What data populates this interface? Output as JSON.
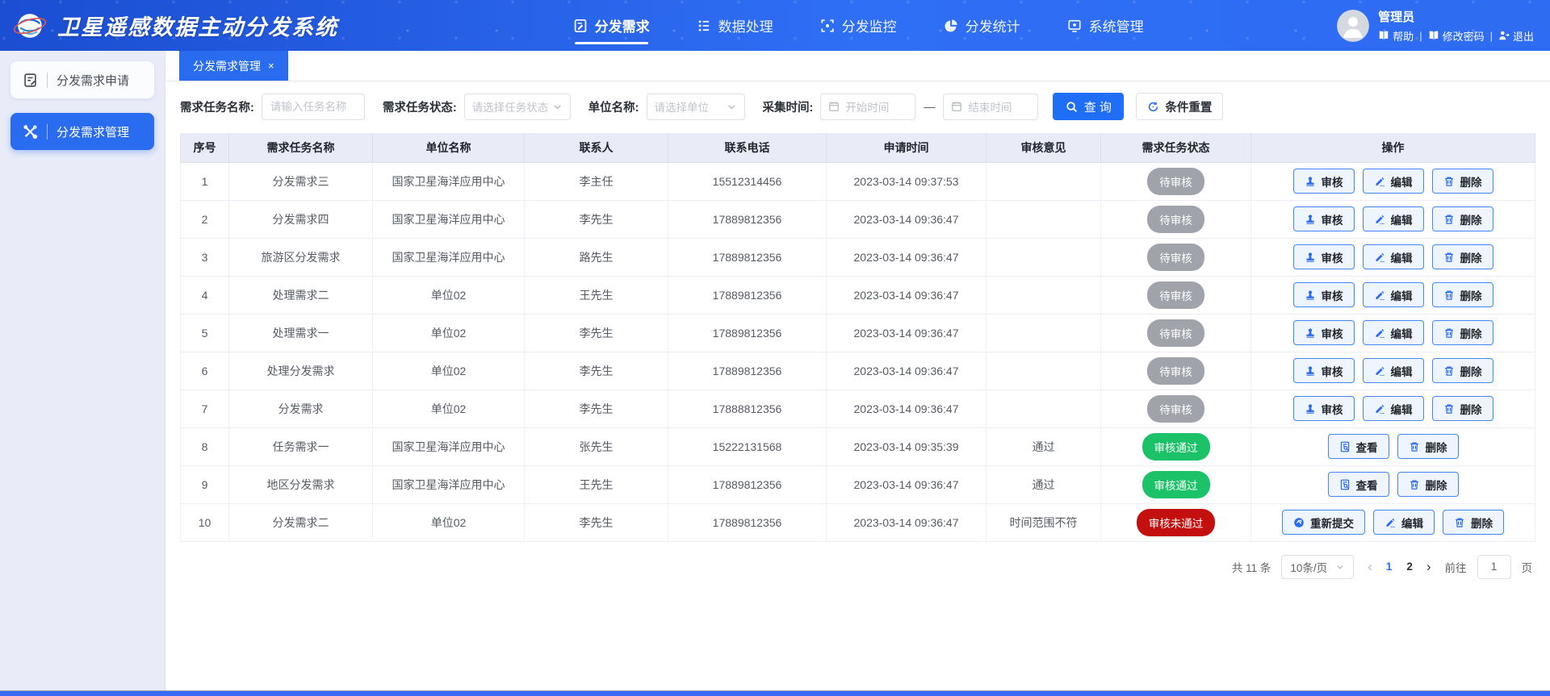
{
  "colors": {
    "accent": "#2a6cf0",
    "header_from": "#1b4ed2",
    "header_to": "#2f6ff5",
    "pending": "#a0a3aa",
    "approved": "#1cc268",
    "rejected": "#c40f0f"
  },
  "header": {
    "title": "卫星遥感数据主动分发系统",
    "nav": [
      {
        "label": "分发需求",
        "name": "distribution-demand",
        "icon": "doc-edit",
        "active": true
      },
      {
        "label": "数据处理",
        "name": "data-processing",
        "icon": "list",
        "active": false
      },
      {
        "label": "分发监控",
        "name": "distribution-monitor",
        "icon": "monitor",
        "active": false
      },
      {
        "label": "分发统计",
        "name": "distribution-stats",
        "icon": "pie",
        "active": false
      },
      {
        "label": "系统管理",
        "name": "system-management",
        "icon": "system",
        "active": false
      }
    ],
    "user": {
      "name": "管理员",
      "links": [
        {
          "label": "帮助",
          "name": "help",
          "icon": "book"
        },
        {
          "label": "修改密码",
          "name": "change-password",
          "icon": "book"
        },
        {
          "label": "退出",
          "name": "logout",
          "icon": "logout"
        }
      ],
      "separator": "|"
    }
  },
  "sidebar": {
    "items": [
      {
        "label": "分发需求申请",
        "name": "demand-apply",
        "icon": "clipboard",
        "active": false
      },
      {
        "label": "分发需求管理",
        "name": "demand-manage",
        "icon": "tools",
        "active": true
      }
    ]
  },
  "tab": {
    "label": "分发需求管理",
    "close": "×"
  },
  "filters": {
    "task_name_label": "需求任务名称:",
    "task_name_placeholder": "请输入任务名称",
    "task_status_label": "需求任务状态:",
    "task_status_placeholder": "请选择任务状态",
    "org_label": "单位名称:",
    "org_placeholder": "请选择单位",
    "time_label": "采集时间:",
    "start_placeholder": "开始时间",
    "end_placeholder": "结束时间",
    "dash": "—",
    "search_label": "查 询",
    "reset_label": "条件重置"
  },
  "table": {
    "columns": [
      "序号",
      "需求任务名称",
      "单位名称",
      "联系人",
      "联系电话",
      "申请时间",
      "审核意见",
      "需求任务状态",
      "操作"
    ],
    "action_sets": {
      "pending": [
        {
          "label": "审核",
          "name": "review",
          "icon": "stamp"
        },
        {
          "label": "编辑",
          "name": "edit",
          "icon": "edit"
        },
        {
          "label": "删除",
          "name": "delete",
          "icon": "delete"
        }
      ],
      "approved": [
        {
          "label": "查看",
          "name": "view",
          "icon": "view"
        },
        {
          "label": "删除",
          "name": "delete",
          "icon": "delete"
        }
      ],
      "rejected": [
        {
          "label": "重新提交",
          "name": "resubmit",
          "icon": "resubmit"
        },
        {
          "label": "编辑",
          "name": "edit",
          "icon": "edit"
        },
        {
          "label": "删除",
          "name": "delete",
          "icon": "delete"
        }
      ]
    },
    "rows": [
      {
        "no": "1",
        "task": "分发需求三",
        "org": "国家卫星海洋应用中心",
        "contact": "李主任",
        "phone": "15512314456",
        "time": "2023-03-14 09:37:53",
        "opinion": "",
        "status": "待审核",
        "status_type": "pending"
      },
      {
        "no": "2",
        "task": "分发需求四",
        "org": "国家卫星海洋应用中心",
        "contact": "李先生",
        "phone": "17889812356",
        "time": "2023-03-14 09:36:47",
        "opinion": "",
        "status": "待审核",
        "status_type": "pending"
      },
      {
        "no": "3",
        "task": "旅游区分发需求",
        "org": "国家卫星海洋应用中心",
        "contact": "路先生",
        "phone": "17889812356",
        "time": "2023-03-14 09:36:47",
        "opinion": "",
        "status": "待审核",
        "status_type": "pending"
      },
      {
        "no": "4",
        "task": "处理需求二",
        "org": "单位02",
        "contact": "王先生",
        "phone": "17889812356",
        "time": "2023-03-14 09:36:47",
        "opinion": "",
        "status": "待审核",
        "status_type": "pending"
      },
      {
        "no": "5",
        "task": "处理需求一",
        "org": "单位02",
        "contact": "李先生",
        "phone": "17889812356",
        "time": "2023-03-14 09:36:47",
        "opinion": "",
        "status": "待审核",
        "status_type": "pending"
      },
      {
        "no": "6",
        "task": "处理分发需求",
        "org": "单位02",
        "contact": "李先生",
        "phone": "17889812356",
        "time": "2023-03-14 09:36:47",
        "opinion": "",
        "status": "待审核",
        "status_type": "pending"
      },
      {
        "no": "7",
        "task": "分发需求",
        "org": "单位02",
        "contact": "李先生",
        "phone": "17888812356",
        "time": "2023-03-14 09:36:47",
        "opinion": "",
        "status": "待审核",
        "status_type": "pending"
      },
      {
        "no": "8",
        "task": "任务需求一",
        "org": "国家卫星海洋应用中心",
        "contact": "张先生",
        "phone": "15222131568",
        "time": "2023-03-14 09:35:39",
        "opinion": "通过",
        "status": "审核通过",
        "status_type": "approved"
      },
      {
        "no": "9",
        "task": "地区分发需求",
        "org": "国家卫星海洋应用中心",
        "contact": "王先生",
        "phone": "17889812356",
        "time": "2023-03-14 09:36:47",
        "opinion": "通过",
        "status": "审核通过",
        "status_type": "approved"
      },
      {
        "no": "10",
        "task": "分发需求二",
        "org": "单位02",
        "contact": "李先生",
        "phone": "17889812356",
        "time": "2023-03-14 09:36:47",
        "opinion": "时间范围不符",
        "status": "审核未通过",
        "status_type": "rejected"
      }
    ]
  },
  "pagination": {
    "total": "共 11 条",
    "page_size": "10条/页",
    "prev": "‹",
    "next": "›",
    "pages": [
      "1",
      "2"
    ],
    "current": "1",
    "goto_label": "前往",
    "goto_value": "1",
    "goto_suffix": "页"
  }
}
